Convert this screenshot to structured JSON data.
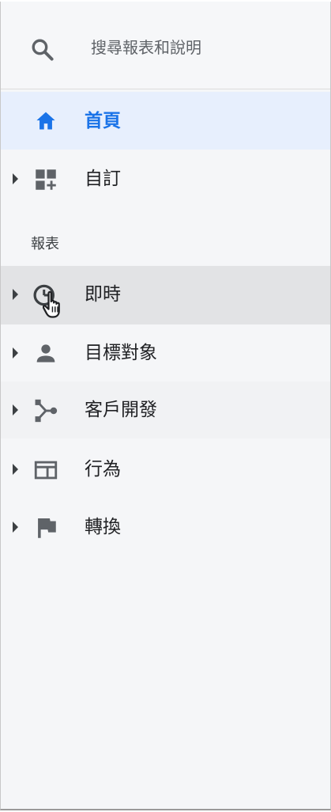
{
  "search": {
    "placeholder": "搜尋報表和說明"
  },
  "nav": {
    "home": "首頁",
    "custom": "自訂",
    "reports_heading": "報表",
    "items": [
      {
        "label": "即時"
      },
      {
        "label": "目標對象"
      },
      {
        "label": "客戶開發"
      },
      {
        "label": "行為"
      },
      {
        "label": "轉換"
      }
    ]
  },
  "colors": {
    "accent": "#1a73e8",
    "selected_background": "#e7effd",
    "hover_background": "#e2e3e5",
    "text": "#202124",
    "icon": "#5f6368"
  }
}
